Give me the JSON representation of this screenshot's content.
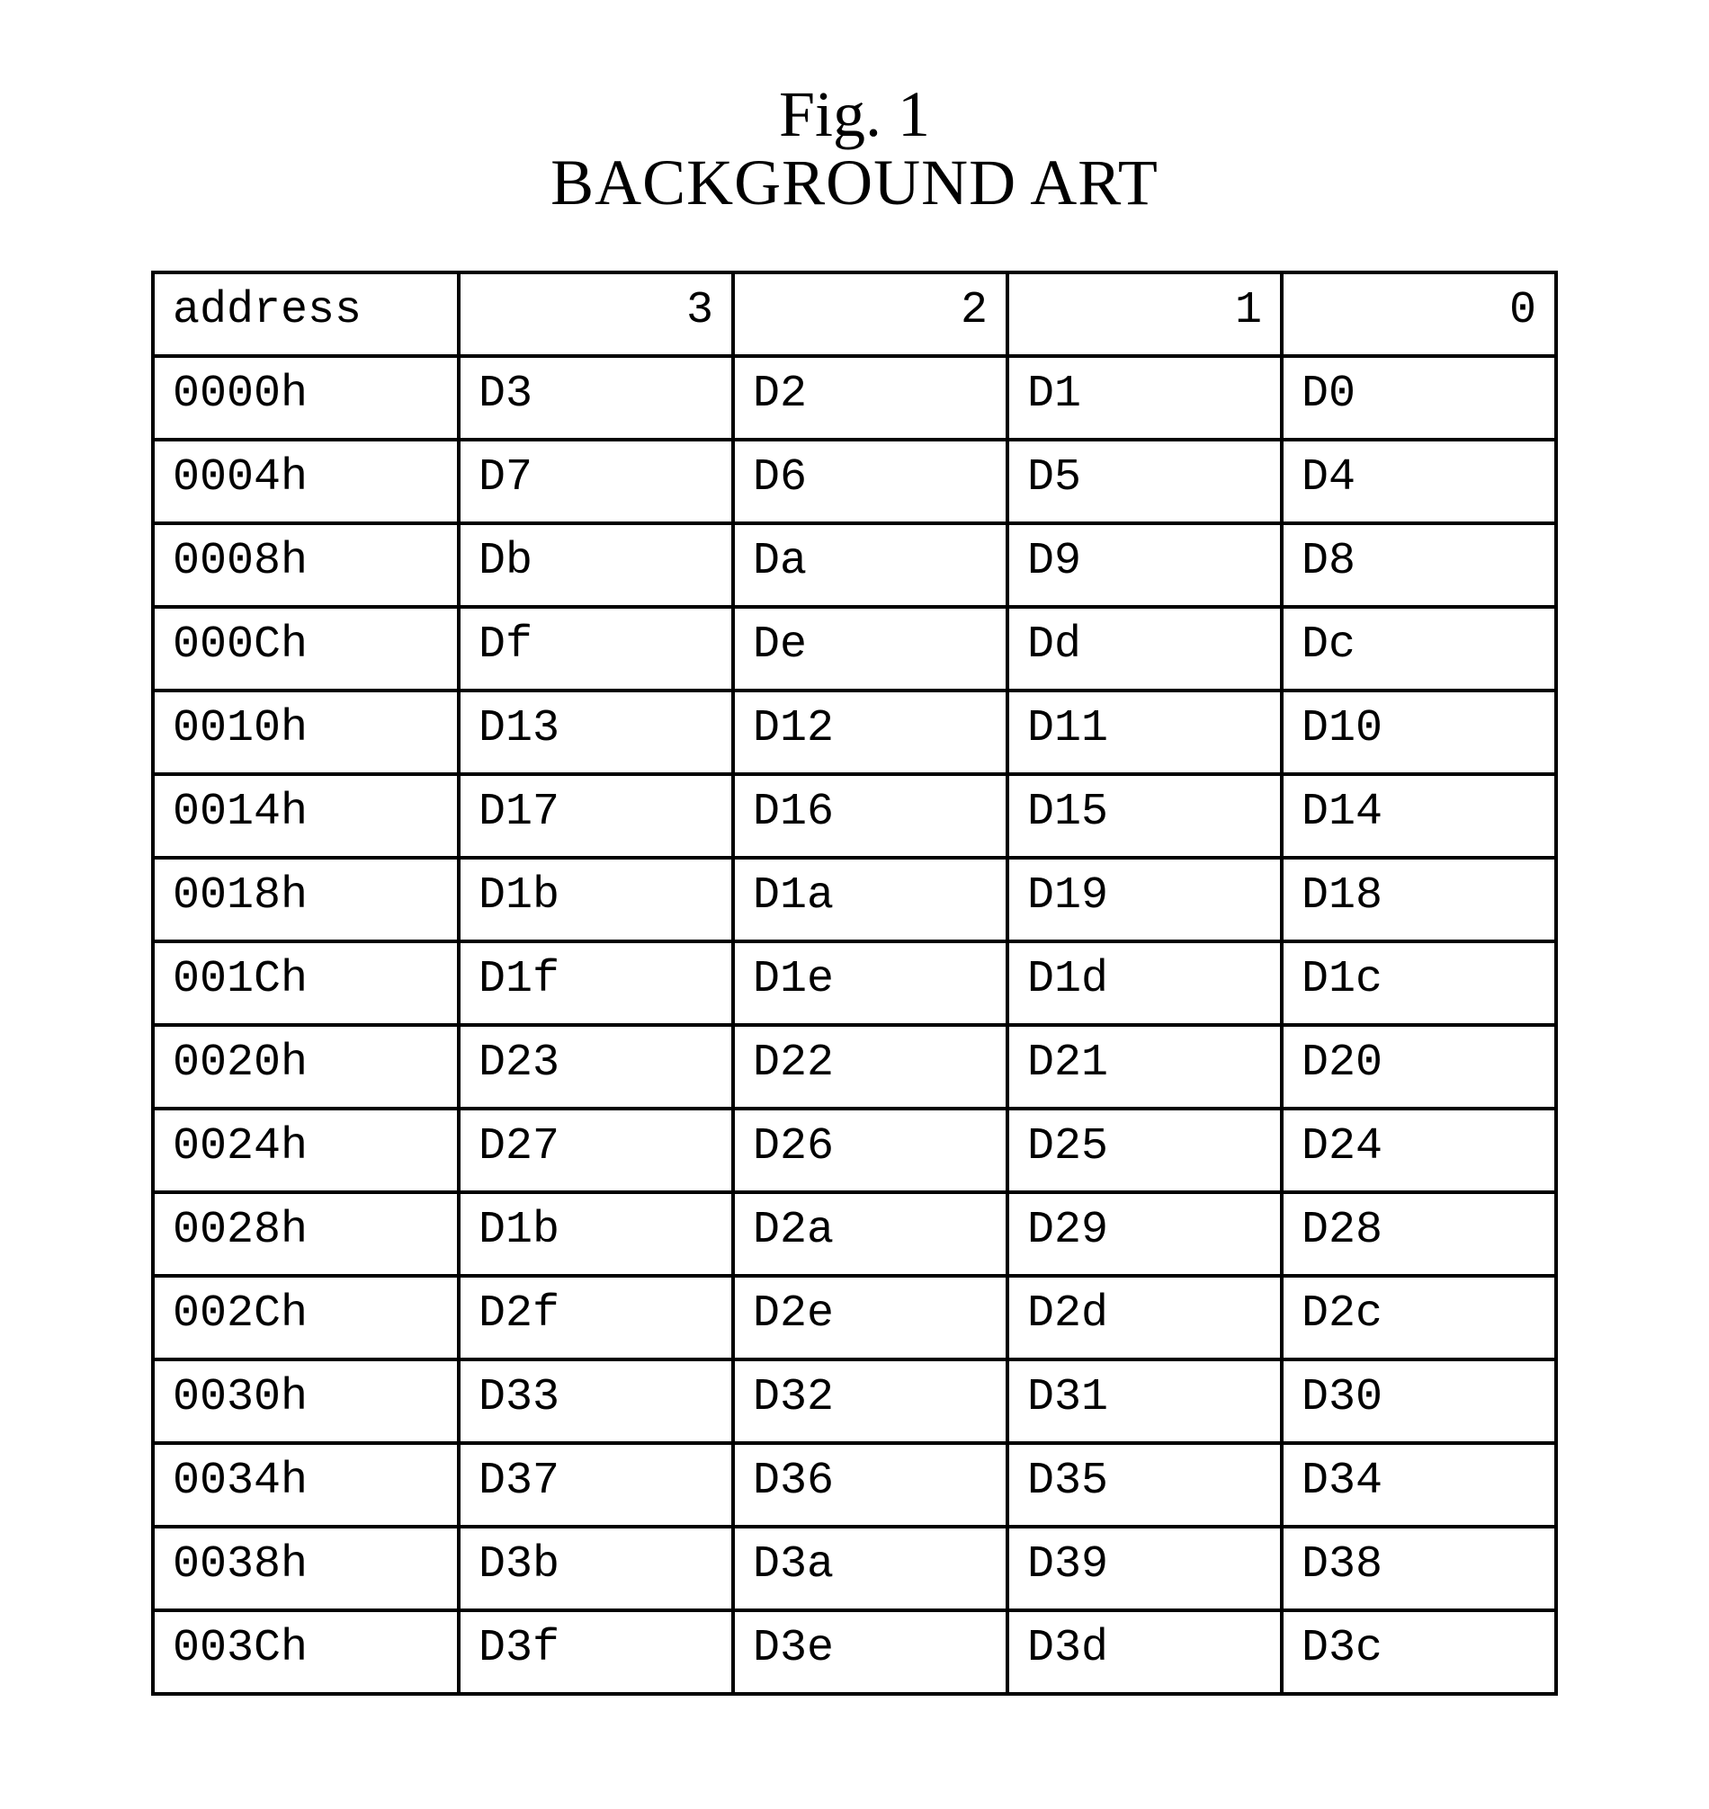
{
  "figure": {
    "label": "Fig. 1",
    "title": "BACKGROUND ART"
  },
  "table": {
    "headers": {
      "address": "address",
      "cols": [
        "3",
        "2",
        "1",
        "0"
      ]
    },
    "rows": [
      {
        "addr": "0000h",
        "cells": [
          "D3",
          "D2",
          "D1",
          "D0"
        ]
      },
      {
        "addr": "0004h",
        "cells": [
          "D7",
          "D6",
          "D5",
          "D4"
        ]
      },
      {
        "addr": "0008h",
        "cells": [
          "Db",
          "Da",
          "D9",
          "D8"
        ]
      },
      {
        "addr": "000Ch",
        "cells": [
          "Df",
          "De",
          "Dd",
          "Dc"
        ]
      },
      {
        "addr": "0010h",
        "cells": [
          "D13",
          "D12",
          "D11",
          "D10"
        ]
      },
      {
        "addr": "0014h",
        "cells": [
          "D17",
          "D16",
          "D15",
          "D14"
        ]
      },
      {
        "addr": "0018h",
        "cells": [
          "D1b",
          "D1a",
          "D19",
          "D18"
        ]
      },
      {
        "addr": "001Ch",
        "cells": [
          "D1f",
          "D1e",
          "D1d",
          "D1c"
        ]
      },
      {
        "addr": "0020h",
        "cells": [
          "D23",
          "D22",
          "D21",
          "D20"
        ]
      },
      {
        "addr": "0024h",
        "cells": [
          "D27",
          "D26",
          "D25",
          "D24"
        ]
      },
      {
        "addr": "0028h",
        "cells": [
          "D1b",
          "D2a",
          "D29",
          "D28"
        ]
      },
      {
        "addr": "002Ch",
        "cells": [
          "D2f",
          "D2e",
          "D2d",
          "D2c"
        ]
      },
      {
        "addr": "0030h",
        "cells": [
          "D33",
          "D32",
          "D31",
          "D30"
        ]
      },
      {
        "addr": "0034h",
        "cells": [
          "D37",
          "D36",
          "D35",
          "D34"
        ]
      },
      {
        "addr": "0038h",
        "cells": [
          "D3b",
          "D3a",
          "D39",
          "D38"
        ]
      },
      {
        "addr": "003Ch",
        "cells": [
          "D3f",
          "D3e",
          "D3d",
          "D3c"
        ]
      }
    ]
  }
}
